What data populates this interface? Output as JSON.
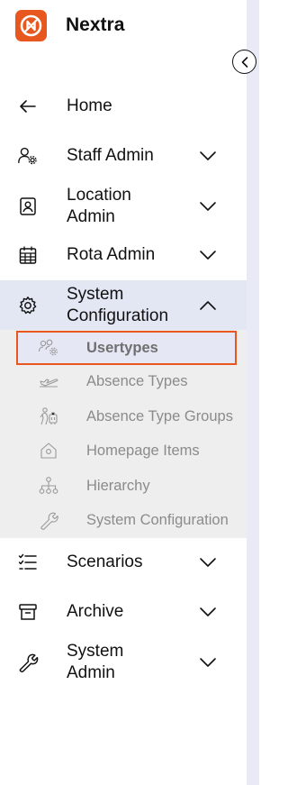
{
  "brand": {
    "name": "Nextra",
    "logo_icon": "nextra-logo-icon",
    "accent": "#e8571e"
  },
  "collapse": {
    "icon": "chevron-left-circle-icon"
  },
  "nav": {
    "home": {
      "label": "Home",
      "icon": "arrow-left-icon"
    },
    "staff_admin": {
      "label": "Staff Admin",
      "icon": "user-gear-icon"
    },
    "location_admin": {
      "label_line1": "Location",
      "label_line2": "Admin",
      "icon": "id-badge-icon"
    },
    "rota_admin": {
      "label": "Rota Admin",
      "icon": "calendar-icon"
    },
    "system_configuration": {
      "label_line1": "System",
      "label_line2": "Configuration",
      "icon": "gear-icon",
      "expanded": true,
      "children": [
        {
          "label": "Usertypes",
          "icon": "users-gear-icon",
          "selected": true
        },
        {
          "label": "Absence Types",
          "icon": "plane-departure-icon"
        },
        {
          "label": "Absence Type Groups",
          "icon": "group-travel-icon"
        },
        {
          "label": "Homepage Items",
          "icon": "home-icon"
        },
        {
          "label": "Hierarchy",
          "icon": "hierarchy-icon"
        },
        {
          "label": "System Configuration",
          "icon": "wrench-icon"
        }
      ]
    },
    "scenarios": {
      "label": "Scenarios",
      "icon": "checklist-icon"
    },
    "archive": {
      "label": "Archive",
      "icon": "archive-box-icon"
    },
    "system_admin": {
      "label_line1": "System",
      "label_line2": "Admin",
      "icon": "wrench-icon"
    }
  },
  "colors": {
    "active_bg": "#e3e6f3",
    "submenu_bg": "#eeeeee",
    "highlight_border": "#e8571e"
  }
}
